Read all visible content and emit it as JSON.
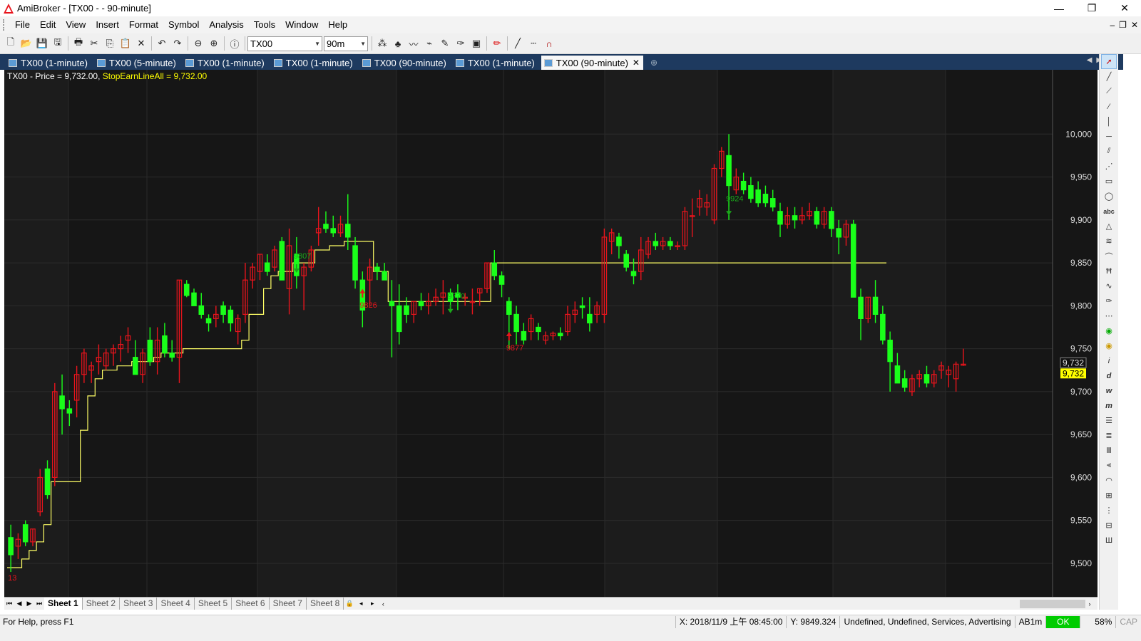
{
  "window": {
    "title": "AmiBroker - [TX00 -  - 90-minute]",
    "controls": [
      "—",
      "❐",
      "✕"
    ]
  },
  "menu": [
    "File",
    "Edit",
    "View",
    "Insert",
    "Format",
    "Symbol",
    "Analysis",
    "Tools",
    "Window",
    "Help"
  ],
  "toolbar": {
    "symbol_value": "TX00",
    "interval_value": "90m"
  },
  "doc_tabs": [
    {
      "label": "TX00 (1-minute)"
    },
    {
      "label": "TX00 (5-minute)"
    },
    {
      "label": "TX00 (1-minute)"
    },
    {
      "label": "TX00 (1-minute)"
    },
    {
      "label": "TX00 (90-minute)"
    },
    {
      "label": "TX00 (1-minute)"
    },
    {
      "label": "TX00 (90-minute)",
      "active": true
    }
  ],
  "chart_header": {
    "price_text": "TX00 - Price = 9,732.00, ",
    "stop_text": "StopEarnLineAll = 9,732.00"
  },
  "sheets": [
    "Sheet 1",
    "Sheet 2",
    "Sheet 3",
    "Sheet 4",
    "Sheet 5",
    "Sheet 6",
    "Sheet 7",
    "Sheet 8"
  ],
  "status": {
    "help": "For Help, press F1",
    "x_coord": "X: 2018/11/9 上午 08:45:00",
    "y_coord": "Y: 9849.324",
    "categories": "Undefined, Undefined, Services, Advertising",
    "db": "AB1m",
    "ok": "OK",
    "pct": "58%",
    "cap": "CAP"
  },
  "colors": {
    "up": "#e8141c",
    "down": "#1aff1a",
    "stop_line": "#ffff66",
    "bg": "#161616",
    "price_label": "#ffff00"
  },
  "chart_data": {
    "type": "candlestick",
    "y_ticks": [
      "10,000",
      "9,950",
      "9,900",
      "9,850",
      "9,800",
      "9,750",
      "9,700",
      "9,650",
      "9,600",
      "9,550",
      "9,500"
    ],
    "y_tick_values": [
      10000,
      9950,
      9900,
      9850,
      9800,
      9750,
      9700,
      9650,
      9600,
      9550,
      9500
    ],
    "ylim": [
      9490,
      10050
    ],
    "last_price_label": "9,732",
    "stop_label": "9,732",
    "candles": [
      [
        9530,
        9545,
        9490,
        9510
      ],
      [
        9520,
        9535,
        9505,
        9528
      ],
      [
        9545,
        9550,
        9520,
        9525
      ],
      [
        9525,
        9540,
        9520,
        9540
      ],
      [
        9560,
        9610,
        9555,
        9600
      ],
      [
        9610,
        9620,
        9575,
        9580
      ],
      [
        9600,
        9710,
        9590,
        9700
      ],
      [
        9695,
        9720,
        9650,
        9680
      ],
      [
        9680,
        9690,
        9660,
        9675
      ],
      [
        9690,
        9730,
        9670,
        9720
      ],
      [
        9720,
        9750,
        9710,
        9745
      ],
      [
        9725,
        9735,
        9710,
        9730
      ],
      [
        9735,
        9755,
        9720,
        9740
      ],
      [
        9730,
        9750,
        9725,
        9745
      ],
      [
        9745,
        9755,
        9730,
        9750
      ],
      [
        9750,
        9765,
        9735,
        9755
      ],
      [
        9760,
        9775,
        9745,
        9765
      ],
      [
        9740,
        9760,
        9725,
        9720
      ],
      [
        9720,
        9750,
        9710,
        9745
      ],
      [
        9760,
        9775,
        9730,
        9735
      ],
      [
        9735,
        9775,
        9720,
        9760
      ],
      [
        9765,
        9780,
        9740,
        9745
      ],
      [
        9745,
        9760,
        9735,
        9740
      ],
      [
        9740,
        9830,
        9710,
        9830
      ],
      [
        9825,
        9830,
        9810,
        9812
      ],
      [
        9815,
        9820,
        9800,
        9800
      ],
      [
        9800,
        9815,
        9785,
        9790
      ],
      [
        9785,
        9790,
        9770,
        9780
      ],
      [
        9785,
        9800,
        9775,
        9790
      ],
      [
        9800,
        9805,
        9780,
        9790
      ],
      [
        9795,
        9800,
        9770,
        9780
      ],
      [
        9770,
        9790,
        9755,
        9785
      ],
      [
        9790,
        9850,
        9780,
        9830
      ],
      [
        9830,
        9850,
        9820,
        9845
      ],
      [
        9840,
        9860,
        9830,
        9860
      ],
      [
        9850,
        9860,
        9835,
        9840
      ],
      [
        9845,
        9870,
        9840,
        9865
      ],
      [
        9875,
        9880,
        9830,
        9830
      ],
      [
        9820,
        9890,
        9790,
        9870
      ],
      [
        9860,
        9880,
        9820,
        9835
      ],
      [
        9835,
        9850,
        9795,
        9845
      ],
      [
        9845,
        9870,
        9840,
        9865
      ],
      [
        9885,
        9915,
        9870,
        9890
      ],
      [
        9895,
        9910,
        9885,
        9890
      ],
      [
        9890,
        9905,
        9880,
        9885
      ],
      [
        9885,
        9905,
        9880,
        9895
      ],
      [
        9895,
        9930,
        9865,
        9880
      ],
      [
        9870,
        9880,
        9820,
        9830
      ],
      [
        9830,
        9840,
        9775,
        9795
      ],
      [
        9830,
        9855,
        9800,
        9845
      ],
      [
        9845,
        9850,
        9830,
        9840
      ],
      [
        9840,
        9850,
        9830,
        9830
      ],
      [
        9805,
        9830,
        9740,
        9800
      ],
      [
        9800,
        9825,
        9755,
        9770
      ],
      [
        9800,
        9810,
        9780,
        9790
      ],
      [
        9790,
        9805,
        9780,
        9805
      ],
      [
        9805,
        9815,
        9795,
        9800
      ],
      [
        9800,
        9815,
        9790,
        9805
      ],
      [
        9805,
        9820,
        9800,
        9810
      ],
      [
        9810,
        9830,
        9790,
        9815
      ],
      [
        9815,
        9820,
        9800,
        9805
      ],
      [
        9815,
        9825,
        9795,
        9810
      ],
      [
        9810,
        9815,
        9800,
        9810
      ],
      [
        9805,
        9820,
        9790,
        9805
      ],
      [
        9815,
        9820,
        9800,
        9820
      ],
      [
        9820,
        9850,
        9815,
        9850
      ],
      [
        9850,
        9865,
        9830,
        9835
      ],
      [
        9835,
        9840,
        9810,
        9825
      ],
      [
        9805,
        9810,
        9750,
        9790
      ],
      [
        9790,
        9800,
        9755,
        9770
      ],
      [
        9770,
        9780,
        9755,
        9760
      ],
      [
        9770,
        9790,
        9760,
        9785
      ],
      [
        9775,
        9780,
        9760,
        9770
      ],
      [
        9760,
        9770,
        9755,
        9765
      ],
      [
        9765,
        9770,
        9760,
        9768
      ],
      [
        9768,
        9775,
        9760,
        9765
      ],
      [
        9770,
        9800,
        9765,
        9790
      ],
      [
        9790,
        9805,
        9780,
        9795
      ],
      [
        9800,
        9810,
        9785,
        9798
      ],
      [
        9790,
        9810,
        9770,
        9780
      ],
      [
        9790,
        9805,
        9780,
        9800
      ],
      [
        9790,
        9890,
        9780,
        9880
      ],
      [
        9875,
        9890,
        9860,
        9885
      ],
      [
        9880,
        9885,
        9855,
        9870
      ],
      [
        9860,
        9865,
        9840,
        9845
      ],
      [
        9840,
        9855,
        9825,
        9835
      ],
      [
        9840,
        9880,
        9830,
        9865
      ],
      [
        9860,
        9880,
        9855,
        9875
      ],
      [
        9875,
        9885,
        9865,
        9870
      ],
      [
        9870,
        9880,
        9865,
        9875
      ],
      [
        9875,
        9880,
        9865,
        9870
      ],
      [
        9870,
        9875,
        9865,
        9870
      ],
      [
        9870,
        9915,
        9865,
        9910
      ],
      [
        9905,
        9925,
        9880,
        9905
      ],
      [
        9915,
        9935,
        9905,
        9925
      ],
      [
        9915,
        9930,
        9905,
        9920
      ],
      [
        9900,
        9965,
        9895,
        9960
      ],
      [
        9960,
        9985,
        9950,
        9980
      ],
      [
        9975,
        10000,
        9900,
        9940
      ],
      [
        9935,
        9960,
        9930,
        9950
      ],
      [
        9945,
        9955,
        9930,
        9935
      ],
      [
        9940,
        9950,
        9920,
        9925
      ],
      [
        9935,
        9945,
        9915,
        9920
      ],
      [
        9930,
        9940,
        9915,
        9920
      ],
      [
        9925,
        9935,
        9910,
        9915
      ],
      [
        9910,
        9920,
        9880,
        9895
      ],
      [
        9895,
        9915,
        9890,
        9905
      ],
      [
        9905,
        9915,
        9890,
        9900
      ],
      [
        9900,
        9915,
        9895,
        9905
      ],
      [
        9905,
        9920,
        9900,
        9910
      ],
      [
        9910,
        9915,
        9890,
        9895
      ],
      [
        9895,
        9915,
        9890,
        9910
      ],
      [
        9910,
        9915,
        9880,
        9890
      ],
      [
        9890,
        9900,
        9860,
        9880
      ],
      [
        9880,
        9900,
        9870,
        9895
      ],
      [
        9895,
        9900,
        9810,
        9810
      ],
      [
        9810,
        9820,
        9760,
        9785
      ],
      [
        9785,
        9810,
        9780,
        9810
      ],
      [
        9810,
        9830,
        9780,
        9790
      ],
      [
        9790,
        9800,
        9755,
        9760
      ],
      [
        9760,
        9770,
        9700,
        9735
      ],
      [
        9730,
        9745,
        9710,
        9710
      ],
      [
        9715,
        9725,
        9700,
        9705
      ],
      [
        9700,
        9720,
        9695,
        9715
      ],
      [
        9715,
        9725,
        9705,
        9720
      ],
      [
        9720,
        9730,
        9705,
        9710
      ],
      [
        9710,
        9725,
        9705,
        9720
      ],
      [
        9725,
        9735,
        9715,
        9730
      ],
      [
        9720,
        9730,
        9705,
        9725
      ],
      [
        9715,
        9735,
        9700,
        9732
      ],
      [
        9732,
        9750,
        9730,
        9732
      ]
    ],
    "stop_line": [
      9495,
      9495,
      9505,
      9515,
      9525,
      9545,
      9595,
      9595,
      9595,
      9595,
      9655,
      9695,
      9715,
      9725,
      9725,
      9730,
      9730,
      9735,
      9735,
      9735,
      9740,
      9745,
      9745,
      9745,
      9750,
      9750,
      9750,
      9750,
      9750,
      9750,
      9750,
      9750,
      9760,
      9790,
      9790,
      9820,
      9835,
      9840,
      9840,
      9850,
      9850,
      9850,
      9865,
      9865,
      9870,
      9870,
      9875,
      9875,
      9875,
      9875,
      9840,
      9840,
      9805,
      9805,
      9805,
      9805,
      9805,
      9805,
      9805,
      9805,
      9805,
      9805,
      9805,
      9805,
      9805,
      9805,
      9850,
      9850,
      9850,
      9850,
      9850,
      9850,
      9850,
      9850,
      9850,
      9850,
      9850,
      9850,
      9850,
      9850,
      9850,
      9850,
      9850,
      9850,
      9850,
      9850,
      9850,
      9850,
      9850,
      9850,
      9850,
      9850,
      9850,
      9850,
      9850,
      9850,
      9850,
      9850,
      9850,
      9850,
      9850,
      9850,
      9850,
      9850,
      9850,
      9850,
      9850,
      9850,
      9850,
      9850,
      9850,
      9850,
      9850,
      9850,
      9850,
      9850,
      9850,
      9850,
      9850,
      9850
    ],
    "annotations": [
      {
        "text": "13",
        "color": "#e8141c",
        "x_index": 0,
        "y": 9480
      },
      {
        "text": "9807",
        "color": "#1aa81a",
        "x_index": 39,
        "y": 9855
      },
      {
        "text": "9826",
        "color": "#e8141c",
        "x_index": 48,
        "y": 9798
      },
      {
        "text": "9770",
        "color": "#1aa81a",
        "x_index": 60,
        "y": 9808
      },
      {
        "text": "9877",
        "color": "#e8141c",
        "x_index": 68,
        "y": 9748
      },
      {
        "text": "9924",
        "color": "#1aa81a",
        "x_index": 98,
        "y": 9922
      }
    ]
  }
}
